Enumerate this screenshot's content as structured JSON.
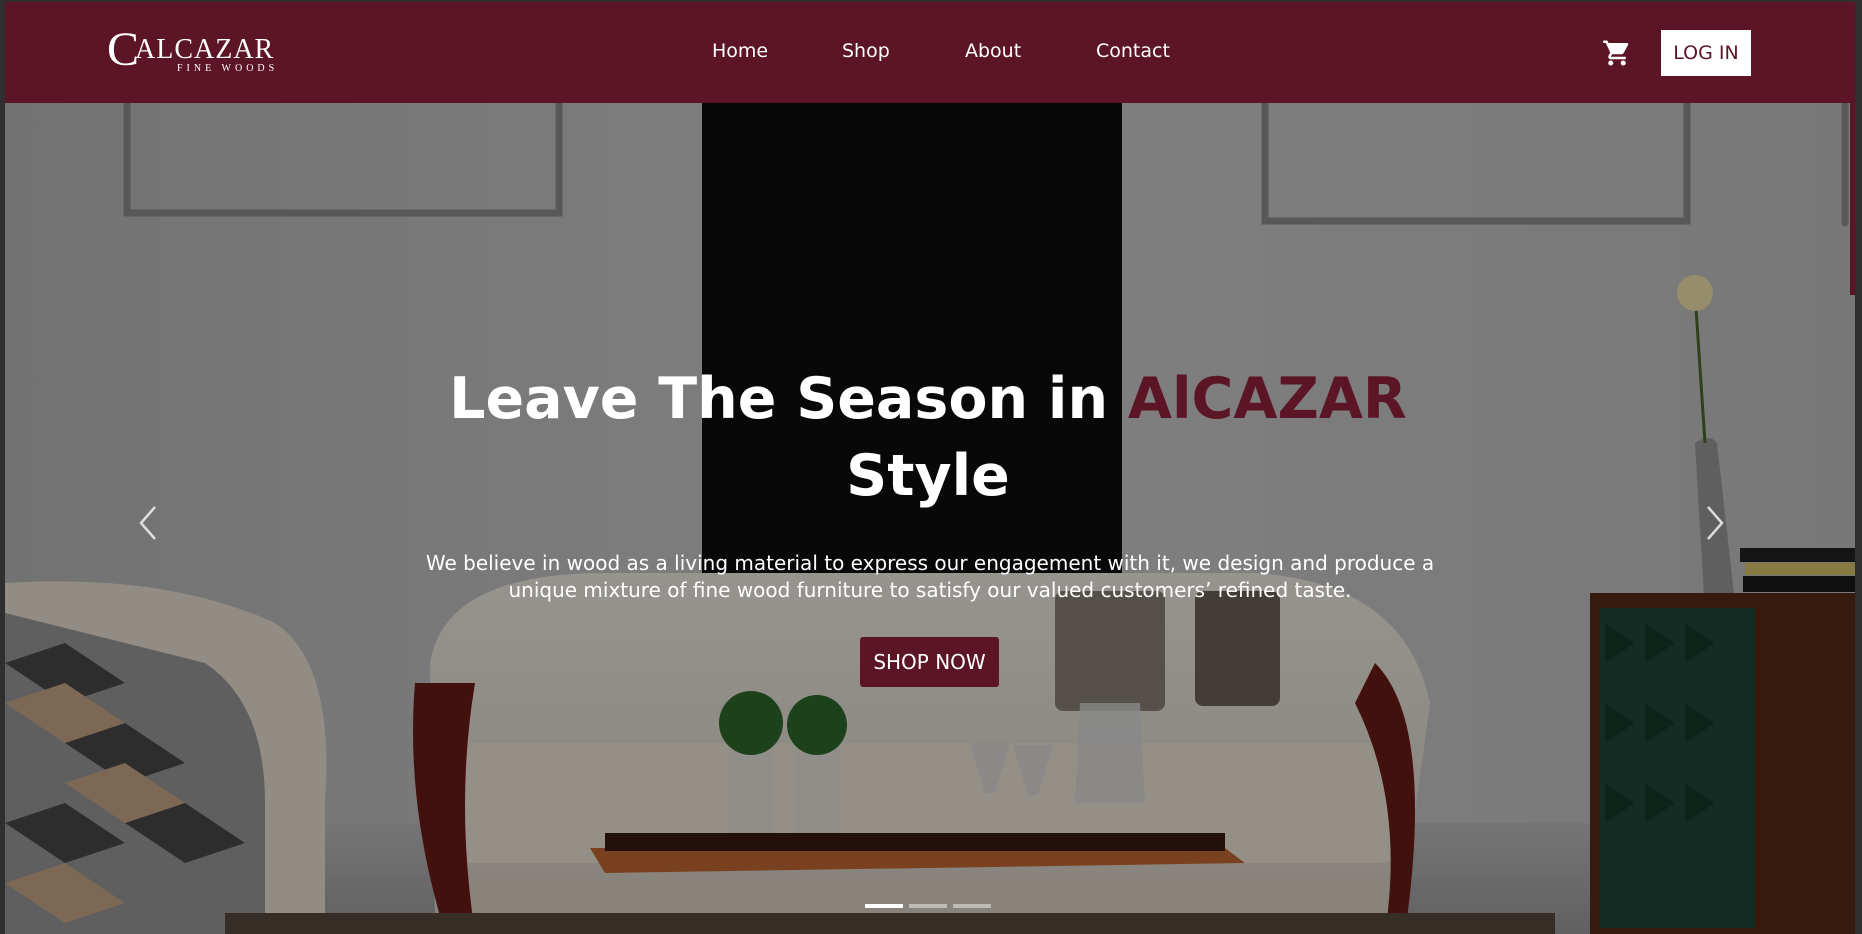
{
  "brand": {
    "logo_letter": "C",
    "logo_name": "ALCAZAR",
    "logo_subtitle": "FINE WOODS",
    "accent_color": "#5c1526"
  },
  "nav": {
    "links": [
      "Home",
      "Shop",
      "About",
      "Contact"
    ],
    "cart_icon": "cart-icon",
    "login_label": "LOG IN"
  },
  "hero": {
    "headline_part1": "Leave The Season in",
    "headline_brand": "AlCAZAR",
    "headline_part2": "Style",
    "tagline": "We believe in wood as a living material to express our engagement with it, we design and produce a unique mixture of fine wood furniture to satisfy our valued customers’ refined taste.",
    "cta_label": "SHOP NOW",
    "prev_icon": "chevron-left-icon",
    "next_icon": "chevron-right-icon",
    "slide_count": 3,
    "active_slide": 1
  }
}
